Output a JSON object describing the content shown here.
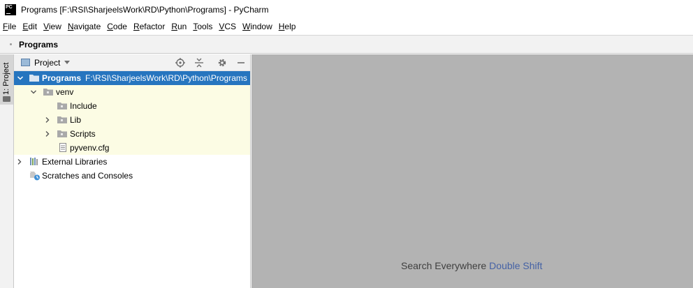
{
  "window": {
    "app_icon_text": "PC",
    "title": "Programs [F:\\RSI\\SharjeelsWork\\RD\\Python\\Programs] - PyCharm"
  },
  "menu": [
    {
      "mnemonic": "F",
      "rest": "ile"
    },
    {
      "mnemonic": "E",
      "rest": "dit"
    },
    {
      "mnemonic": "V",
      "rest": "iew"
    },
    {
      "mnemonic": "N",
      "rest": "avigate"
    },
    {
      "mnemonic": "C",
      "rest": "ode"
    },
    {
      "mnemonic": "R",
      "rest": "efactor"
    },
    {
      "mnemonic": "R",
      "rest": "un"
    },
    {
      "mnemonic": "T",
      "rest": "ools"
    },
    {
      "mnemonic": "V",
      "rest": "CS"
    },
    {
      "mnemonic": "W",
      "rest": "indow"
    },
    {
      "mnemonic": "H",
      "rest": "elp"
    }
  ],
  "navbar": {
    "crumb": "Programs"
  },
  "toolstrip": {
    "project_tab": "1: Project"
  },
  "project_panel": {
    "title": "Project",
    "tree": {
      "root": {
        "name": "Programs",
        "path": "F:\\RSI\\SharjeelsWork\\RD\\Python\\Programs"
      },
      "venv": "venv",
      "include": "Include",
      "lib": "Lib",
      "scripts": "Scripts",
      "pyvenv": "pyvenv.cfg",
      "external": "External Libraries",
      "scratches": "Scratches and Consoles"
    }
  },
  "editor": {
    "hint_text": "Search Everywhere",
    "hint_shortcut": "Double Shift"
  },
  "colors": {
    "selection": "#2675bf",
    "venv_highlight": "#fcfce4",
    "editor_bg": "#b3b3b3",
    "shortcut": "#4562a5"
  }
}
